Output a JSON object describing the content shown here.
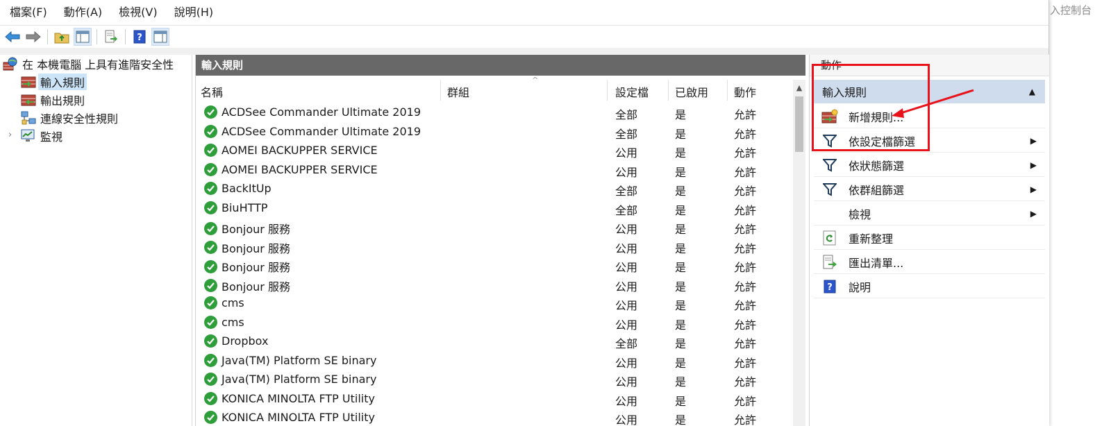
{
  "menu": [
    "檔案(F)",
    "動作(A)",
    "檢視(V)",
    "說明(H)"
  ],
  "background_caption": "入控制台",
  "tree": {
    "root": "在 本機電腦 上具有進階安全性",
    "items": [
      "輸入規則",
      "輸出規則",
      "連線安全性規則",
      "監視"
    ]
  },
  "list": {
    "title": "輸入規則",
    "columns": [
      "名稱",
      "群組",
      "設定檔",
      "已啟用",
      "動作"
    ],
    "rows": [
      {
        "name": "ACDSee Commander Ultimate 2019",
        "profile": "全部",
        "enabled": "是",
        "action": "允許"
      },
      {
        "name": "ACDSee Commander Ultimate 2019",
        "profile": "全部",
        "enabled": "是",
        "action": "允許"
      },
      {
        "name": "AOMEI BACKUPPER SERVICE",
        "profile": "公用",
        "enabled": "是",
        "action": "允許"
      },
      {
        "name": "AOMEI BACKUPPER SERVICE",
        "profile": "公用",
        "enabled": "是",
        "action": "允許"
      },
      {
        "name": "BackItUp",
        "profile": "全部",
        "enabled": "是",
        "action": "允許"
      },
      {
        "name": "BiuHTTP",
        "profile": "全部",
        "enabled": "是",
        "action": "允許"
      },
      {
        "name": "Bonjour 服務",
        "profile": "公用",
        "enabled": "是",
        "action": "允許"
      },
      {
        "name": "Bonjour 服務",
        "profile": "公用",
        "enabled": "是",
        "action": "允許"
      },
      {
        "name": "Bonjour 服務",
        "profile": "公用",
        "enabled": "是",
        "action": "允許"
      },
      {
        "name": "Bonjour 服務",
        "profile": "公用",
        "enabled": "是",
        "action": "允許"
      },
      {
        "name": "cms",
        "profile": "公用",
        "enabled": "是",
        "action": "允許"
      },
      {
        "name": "cms",
        "profile": "公用",
        "enabled": "是",
        "action": "允許"
      },
      {
        "name": "Dropbox",
        "profile": "全部",
        "enabled": "是",
        "action": "允許"
      },
      {
        "name": "Java(TM) Platform SE binary",
        "profile": "公用",
        "enabled": "是",
        "action": "允許"
      },
      {
        "name": "Java(TM) Platform SE binary",
        "profile": "公用",
        "enabled": "是",
        "action": "允許"
      },
      {
        "name": "KONICA MINOLTA FTP Utility",
        "profile": "公用",
        "enabled": "是",
        "action": "允許"
      },
      {
        "name": "KONICA MINOLTA FTP Utility",
        "profile": "公用",
        "enabled": "是",
        "action": "允許"
      }
    ]
  },
  "actions": {
    "title": "動作",
    "section": "輸入規則",
    "items": [
      {
        "label": "新增規則...",
        "icon": "new-rule-icon"
      },
      {
        "label": "依設定檔篩選",
        "icon": "filter-icon",
        "submenu": true
      },
      {
        "label": "依狀態篩選",
        "icon": "filter-icon",
        "submenu": true
      },
      {
        "label": "依群組篩選",
        "icon": "filter-icon",
        "submenu": true
      },
      {
        "label": "檢視",
        "icon": "",
        "submenu": true
      },
      {
        "label": "重新整理",
        "icon": "refresh-icon"
      },
      {
        "label": "匯出清單...",
        "icon": "export-icon"
      },
      {
        "label": "說明",
        "icon": "help-icon"
      }
    ]
  },
  "colors": {
    "annotation": "#e8121a",
    "title_bar": "#686868",
    "section_bg": "#cfdcee",
    "check_green": "#2e9e3a"
  }
}
